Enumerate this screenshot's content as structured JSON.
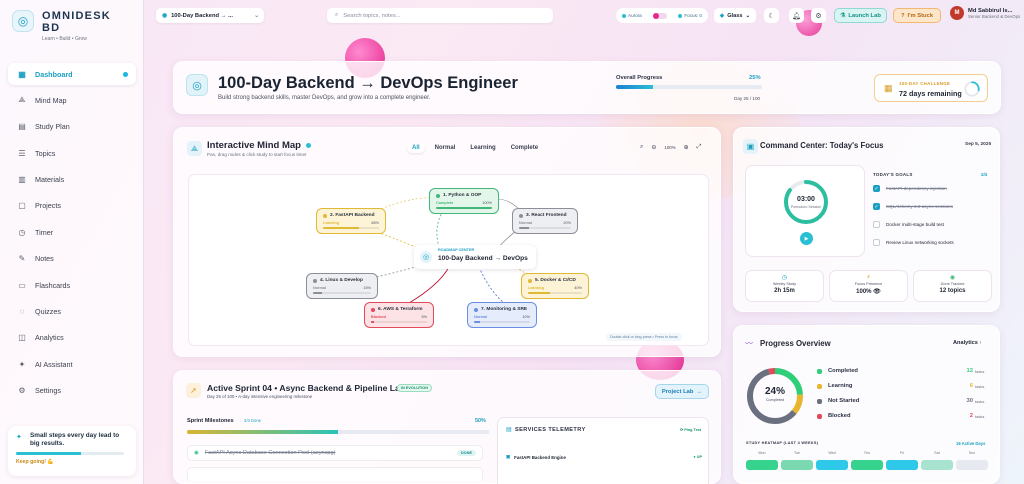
{
  "brand": {
    "name": "OMNIDESK BD",
    "tagline": "Learn • Build • Grow"
  },
  "sidebar": {
    "items": [
      {
        "label": "Dashboard",
        "icon": "dashboard-icon",
        "active": true
      },
      {
        "label": "Mind Map",
        "icon": "mindmap-icon"
      },
      {
        "label": "Study Plan",
        "icon": "study-plan-icon"
      },
      {
        "label": "Topics",
        "icon": "topics-icon"
      },
      {
        "label": "Materials",
        "icon": "materials-icon"
      },
      {
        "label": "Projects",
        "icon": "projects-icon"
      },
      {
        "label": "Timer",
        "icon": "timer-icon"
      },
      {
        "label": "Notes",
        "icon": "notes-icon"
      },
      {
        "label": "Flashcards",
        "icon": "flashcards-icon"
      },
      {
        "label": "Quizzes",
        "icon": "quizzes-icon"
      },
      {
        "label": "Analytics",
        "icon": "analytics-icon"
      },
      {
        "label": "AI Assistant",
        "icon": "ai-assistant-icon"
      },
      {
        "label": "Settings",
        "icon": "settings-icon"
      }
    ],
    "tip": {
      "text": "Small steps every day lead to big results.",
      "sub": "Keep going! 💪",
      "progress": 0.6
    }
  },
  "topbar": {
    "plan_select": "100-Day Backend → ...",
    "search_placeholder": "Search topics, notes...",
    "status": {
      "left": "Aurora",
      "right": "Focus: 0"
    },
    "theme_select": "Glass",
    "launch_label": "Launch Lab",
    "stuck_label": "I'm Stuck",
    "user": {
      "initial": "M",
      "name": "Md Sabbirul Is...",
      "role": "Senior Backend & DevOps"
    }
  },
  "hero": {
    "title": "100-Day Backend → DevOps Engineer",
    "subtitle": "Build strong backend skills, master DevOps, and grow into a complete engineer.",
    "progress_label": "Overall Progress",
    "progress_value": "25%",
    "progress_fraction": 0.25,
    "day_text": "Day 25 / 100",
    "remaining_label": "100-DAY CHALLENGE",
    "remaining_value": "72 days remaining",
    "remaining_fraction": 0.28
  },
  "mindmap": {
    "title": "Interactive Mind Map",
    "subtitle": "Pan, drag nodes & click study to start focus timer",
    "filters": [
      "All",
      "Normal",
      "Learning",
      "Complete"
    ],
    "zoom": "100%",
    "center": {
      "label": "ROADMAP CENTER",
      "name": "100-Day Backend → DevOps"
    },
    "hint": "Double-click or long-press • Press to focus",
    "nodes": [
      {
        "name": "1. Python & OOP",
        "status": "Complete",
        "pct": "100%",
        "fill": 1.0,
        "color": "#43b77a",
        "bg": "#e3f6ea"
      },
      {
        "name": "2. FastAPI Backend",
        "status": "Learning",
        "pct": "65%",
        "fill": 0.65,
        "color": "#e0b935",
        "bg": "#fdf3d6"
      },
      {
        "name": "3. React Frontend",
        "status": "Normal",
        "pct": "20%",
        "fill": 0.2,
        "color": "#8c8f98",
        "bg": "#eeeff2"
      },
      {
        "name": "4. Linux & Develop",
        "status": "Normal",
        "pct": "15%",
        "fill": 0.15,
        "color": "#8c8f98",
        "bg": "#eeeff2"
      },
      {
        "name": "5. Docker & CI/CD",
        "status": "Learning",
        "pct": "40%",
        "fill": 0.4,
        "color": "#e0b935",
        "bg": "#fdf3d6"
      },
      {
        "name": "6. AWS & Terraform",
        "status": "Blocked",
        "pct": "5%",
        "fill": 0.05,
        "color": "#e04a5a",
        "bg": "#fde3e6"
      },
      {
        "name": "7. Monitoring & SRE",
        "status": "Normal",
        "pct": "10%",
        "fill": 0.1,
        "color": "#6b8fe0",
        "bg": "#e5ecfb"
      }
    ]
  },
  "command": {
    "title": "Command Center: Today's Focus",
    "date": "Sep 5, 2025",
    "timer": {
      "time": "03:00",
      "mode": "Pomodoro Session",
      "fraction": 0.85
    },
    "goals_header": "TODAY'S GOALS",
    "goals_count": "2/4",
    "goals": [
      {
        "text": "FastAPI dependency injection",
        "done": true
      },
      {
        "text": "SQLAlchemy 2.0 async sessions",
        "done": true
      },
      {
        "text": "Docker multi-stage build test",
        "done": false
      },
      {
        "text": "Review Linux networking sockets",
        "done": false
      }
    ],
    "stats": [
      {
        "label": "Weekly Study",
        "value": "2h 15m",
        "icon": "clock-icon",
        "color": "#1a9fc2"
      },
      {
        "label": "Focus Presence",
        "value": "100% 👁",
        "icon": "bolt-icon",
        "color": "#d99a25"
      },
      {
        "label": "Done Tracked",
        "value": "12 topics",
        "icon": "check-circle-icon",
        "color": "#43b77a"
      }
    ]
  },
  "progress": {
    "title": "Progress Overview",
    "link": "Analytics",
    "percent": "24%",
    "percent_label": "Completed",
    "legend": [
      {
        "name": "Completed",
        "value": "12",
        "unit": "tasks",
        "color": "#2fcf7a",
        "count": 12
      },
      {
        "name": "Learning",
        "value": "6",
        "unit": "tasks",
        "color": "#e8b52f",
        "count": 6
      },
      {
        "name": "Not Started",
        "value": "30",
        "unit": "tasks",
        "color": "#6b7080",
        "count": 30
      },
      {
        "name": "Blocked",
        "value": "2",
        "unit": "tasks",
        "color": "#e04a5a",
        "count": 2
      }
    ],
    "heat_header": "STUDY HEATMAP (LAST 4 WEEKS)",
    "heat_count": "16 Active Days",
    "heat_days": [
      "Mon",
      "Tue",
      "Wed",
      "Thu",
      "Fri",
      "Sat",
      "Sun"
    ],
    "heat_colors": [
      "#35d38e",
      "#7ad9b0",
      "#2ec8e8",
      "#35d38e",
      "#2ec8e8",
      "#a8e3cf",
      "#e6e9ef"
    ]
  },
  "sprint": {
    "title": "Active Sprint 04 • Async Backend & Pipeline Lab",
    "badge": "IN EVOLUTION",
    "subtitle": "Day 25 of 100 • A-day intensive engineering milestone",
    "button": "Project Lab",
    "milestones_label": "Sprint Milestones",
    "milestones_count": "2/4 Done",
    "milestones_pct": "50%",
    "milestones_fraction": 0.5,
    "item_text": "FastAPI Async Database Connection Pool (asyncpg)",
    "item_status": "DONE",
    "telemetry_header": "SERVICES TELEMETRY",
    "telemetry_live": "Ping Test",
    "telemetry_row": {
      "name": "FastAPI Backend Engine",
      "status": "● UP"
    }
  }
}
